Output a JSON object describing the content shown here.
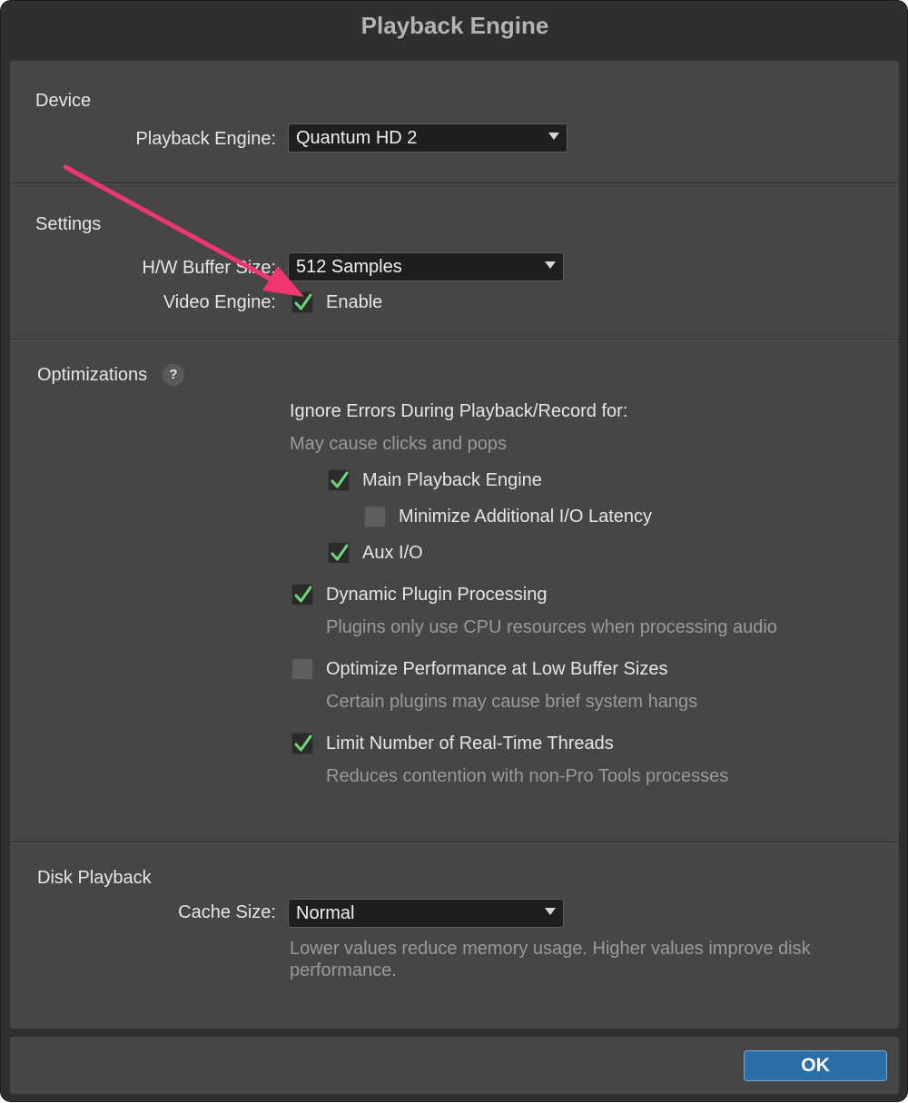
{
  "window": {
    "title": "Playback Engine"
  },
  "device": {
    "title": "Device",
    "playback_engine_label": "Playback Engine:",
    "playback_engine_value": "Quantum HD 2"
  },
  "settings": {
    "title": "Settings",
    "buffer_label": "H/W Buffer Size:",
    "buffer_value": "512 Samples",
    "video_label": "Video Engine:",
    "video_enable": "Enable",
    "video_checked": true
  },
  "optimizations": {
    "title": "Optimizations",
    "help": "?",
    "ignore_heading": "Ignore Errors During Playback/Record for:",
    "ignore_sub": "May cause clicks and pops",
    "items": [
      {
        "label": "Main Playback Engine",
        "checked": true
      },
      {
        "label": "Minimize Additional I/O Latency",
        "checked": false
      },
      {
        "label": "Aux I/O",
        "checked": true
      },
      {
        "label": "Dynamic Plugin Processing",
        "checked": true,
        "desc": "Plugins only use CPU resources when processing audio"
      },
      {
        "label": "Optimize Performance at Low Buffer Sizes",
        "checked": false,
        "desc": "Certain plugins may cause brief system hangs"
      },
      {
        "label": "Limit Number of Real-Time Threads",
        "checked": true,
        "desc": "Reduces contention with non-Pro Tools processes"
      }
    ]
  },
  "disk": {
    "title": "Disk Playback",
    "cache_label": "Cache Size:",
    "cache_value": "Normal",
    "note_line1": "Lower values reduce memory usage. Higher values improve disk",
    "note_line2": "performance."
  },
  "footer": {
    "ok_label": "OK"
  },
  "colors": {
    "accent": "#2b6ea8",
    "check": "#6fd67a",
    "annotation_arrow": "#f0366f"
  }
}
